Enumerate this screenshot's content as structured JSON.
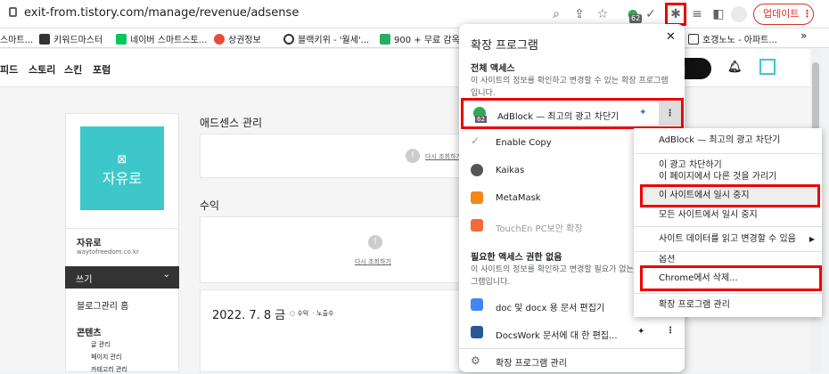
{
  "browser": {
    "url": "exit-from.tistory.com/manage/revenue/adsense",
    "update_label": "업데이트",
    "badge": "62",
    "bookmarks": [
      "스마트...",
      "키워드마스터",
      "네이버 스마트스토...",
      "상권정보",
      "블랙키위 - '월세'...",
      "900 + 무료 감옥...",
      "호갱노노 - 아파트..."
    ],
    "more_bookmarks": "»"
  },
  "site": {
    "nav": [
      "피드",
      "스토리",
      "스킨",
      "포럼"
    ],
    "blog_name": "자유로",
    "blog_url": "waytofreedom.co.kr",
    "write_label": "쓰기",
    "menu": {
      "home": "블로그관리 홈",
      "contents": "콘텐츠",
      "items": [
        "글 관리",
        "페이지 관리",
        "카테고리 관리"
      ]
    },
    "adsense_title": "애드센스 관리",
    "revenue_title": "수익",
    "retry_link": "다시 조회하기",
    "date_label": "2022. 7. 8 금",
    "legend": [
      "수익",
      "노출수"
    ]
  },
  "extensions": {
    "title": "확장 프로그램",
    "full_access_heading": "전체 액세스",
    "full_access_desc": "이 사이트의 정보를 확인하고 변경할 수 있는 확장 프로그램입니다.",
    "full_access": [
      {
        "name": "AdBlock — 최고의 광고 차단기",
        "badge": "62",
        "pinned": true
      }
    ],
    "no_access_items": [
      "Enable Copy",
      "Kaikas",
      "MetaMask",
      "TouchEn PC보안 확장"
    ],
    "no_access_heading": "필요한 액세스 권한 없음",
    "no_access_desc": "이 사이트의 정보를 확인하고 변경할 필요가 없는 확장 프로그램입니다.",
    "need_items": [
      "doc 및 docx 용 문서 편집기",
      "DocsWork 문서에 대 한 편집..."
    ],
    "manage_label": "확장 프로그램 관리"
  },
  "context_menu": {
    "items": [
      "AdBlock — 최고의 광고 차단기",
      "이 광고 차단하기",
      "이 페이지에서 다른 것을 가리기",
      "이 사이트에서 일시 중지",
      "모든 사이트에서 일시 중지",
      "사이트 데이터를 읽고 변경할 수 있음",
      "옵션",
      "Chrome에서 삭제...",
      "확장 프로그램 관리"
    ],
    "highlighted": "이 사이트에서 일시 중지"
  },
  "colors": {
    "accent": "#3ec7c9",
    "highlight": "#e00000",
    "update": "#d93025"
  }
}
